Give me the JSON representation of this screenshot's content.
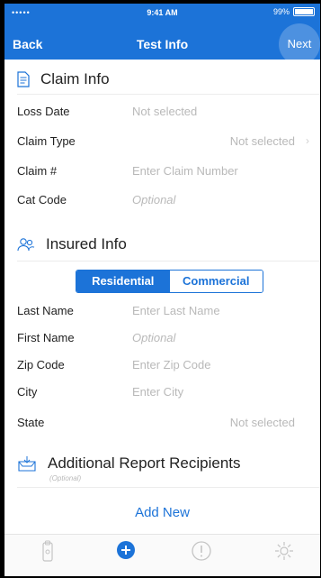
{
  "status_bar": {
    "signal": "••••• ",
    "time": "9:41 AM",
    "battery": "99%"
  },
  "nav": {
    "back_label": "Back",
    "title": "Test Info",
    "next_label": "Next"
  },
  "claim_info": {
    "heading": "Claim Info",
    "rows": [
      {
        "label": "Loss Date",
        "value": "Not selected"
      },
      {
        "label": "Claim Type",
        "value": "Not selected"
      },
      {
        "label": "Claim #",
        "value": "Enter Claim Number"
      },
      {
        "label": "Cat Code",
        "value": "Optional"
      }
    ]
  },
  "insured_info": {
    "heading": "Insured Info",
    "segments": [
      "Residential",
      "Commercial"
    ],
    "selected_segment": "Residential",
    "rows": [
      {
        "label": "Last Name",
        "value": "Enter Last Name"
      },
      {
        "label": "First Name",
        "value": "Optional"
      },
      {
        "label": "Zip Code",
        "value": "Enter Zip Code"
      },
      {
        "label": "City",
        "value": "Enter City"
      },
      {
        "label": "State",
        "value": "Not selected"
      }
    ]
  },
  "recipients": {
    "heading": "Additional Report Recipients",
    "sub": "(Optional)",
    "add_label": "Add New"
  },
  "tabbar": {
    "icons": [
      "clipboard-icon",
      "add-circle-icon",
      "alert-icon",
      "settings-icon"
    ]
  },
  "colors": {
    "accent": "#1c73d8",
    "placeholder": "#b9b9b9"
  }
}
